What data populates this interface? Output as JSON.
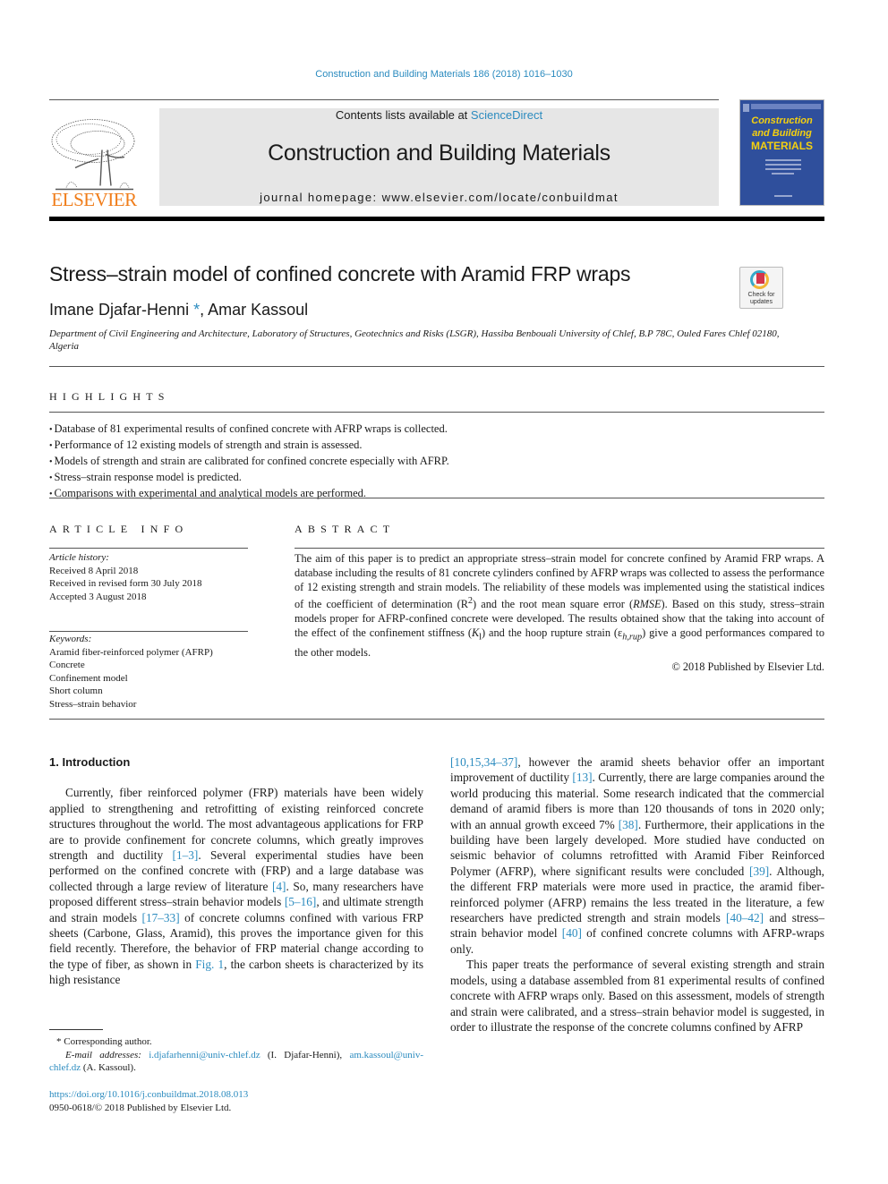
{
  "journal_ref": "Construction and Building Materials 186 (2018) 1016–1030",
  "publisher": {
    "logo_word": "ELSEVIER",
    "icon": "elsevier-tree-logo"
  },
  "banner": {
    "contents_prefix": "Contents lists available at ",
    "contents_link": "ScienceDirect",
    "journal_title": "Construction and Building Materials",
    "homepage": "journal homepage: www.elsevier.com/locate/conbuildmat"
  },
  "cover": {
    "line1": "Construction",
    "line2": "and Building",
    "line3": "MATERIALS"
  },
  "article": {
    "title": "Stress–strain model of confined concrete with Aramid FRP wraps",
    "author1": "Imane Djafar-Henni",
    "author1_mark": "*",
    "author_sep": ", ",
    "author2": "Amar Kassoul",
    "affiliation": "Department of Civil Engineering and Architecture, Laboratory of Structures, Geotechnics and Risks (LSGR), Hassiba Benbouali University of Chlef, B.P 78C, Ouled Fares Chlef 02180, Algeria",
    "check_updates": {
      "line1": "Check for",
      "line2": "updates"
    }
  },
  "highlights": {
    "heading": "HIGHLIGHTS",
    "items": [
      "Database of 81 experimental results of confined concrete with AFRP wraps is collected.",
      "Performance of 12 existing models of strength and strain is assessed.",
      "Models of strength and strain are calibrated for confined concrete especially with AFRP.",
      "Stress–strain response model is predicted.",
      "Comparisons with experimental and analytical models are performed."
    ]
  },
  "article_info": {
    "heading": "ARTICLE INFO",
    "history_label": "Article history:",
    "history": [
      "Received 8 April 2018",
      "Received in revised form 30 July 2018",
      "Accepted 3 August 2018"
    ],
    "keywords_label": "Keywords:",
    "keywords": [
      "Aramid fiber-reinforced polymer (AFRP)",
      "Concrete",
      "Confinement model",
      "Short column",
      "Stress–strain behavior"
    ]
  },
  "abstract": {
    "heading": "ABSTRACT",
    "p1": "The aim of this paper is to predict an appropriate stress–strain model for concrete confined by Aramid FRP wraps. A database including the results of 81 concrete cylinders confined by AFRP wraps was collected to assess the performance of 12 existing strength and strain models. The reliability of these models was implemented using the statistical indices of the coefficient of determination (R",
    "sup": "2",
    "p2": ") and the root mean square error (",
    "rmse": "RMSE",
    "p3": "). Based on this study, stress–strain models proper for AFRP-confined concrete were developed. The results obtained show that the taking into account of the effect of the confinement stiffness (",
    "kl": "K",
    "kl_sub": "l",
    "p4": ") and the hoop rupture strain (",
    "eps": "ε",
    "eps_sub": "h,rup",
    "p5": ") give a good performances compared to the other models.",
    "copyright": "© 2018 Published by Elsevier Ltd."
  },
  "intro": {
    "heading": "1. Introduction",
    "left": {
      "t1": "Currently, fiber reinforced polymer (FRP) materials have been widely applied to strengthening and retrofitting of existing reinforced concrete structures throughout the world. The most advantageous applications for FRP are to provide confinement for concrete columns, which greatly improves strength and ductility ",
      "r1": "[1–3]",
      "t2": ". Several experimental studies have been performed on the confined concrete with (FRP) and a large database was collected through a large review of literature ",
      "r2": "[4]",
      "t3": ". So, many researchers have proposed different stress–strain behavior models ",
      "r3": "[5–16]",
      "t4": ", and ultimate strength and strain models ",
      "r4": "[17–33]",
      "t5": " of concrete columns confined with various FRP sheets (Carbone, Glass, Aramid), this proves the importance given for this field recently. Therefore, the behavior of FRP material change according to the type of fiber, as shown in ",
      "r5": "Fig. 1",
      "t6": ", the carbon sheets is characterized by its high resistance"
    },
    "right": {
      "r1": "[10,15,34–37]",
      "t1": ", however the aramid sheets behavior offer an important improvement of ductility ",
      "r2": "[13]",
      "t2": ". Currently, there are large companies around the world producing this material. Some research indicated that the commercial demand of aramid fibers is more than 120 thousands of tons in 2020 only; with an annual growth exceed 7% ",
      "r3": "[38]",
      "t3": ". Furthermore, their applications in the building have been largely developed. More studied have conducted on seismic behavior of columns retrofitted with Aramid Fiber Reinforced Polymer (AFRP), where significant results were concluded ",
      "r4": "[39]",
      "t4": ". Although, the different FRP materials were more used in practice, the aramid fiber-reinforced polymer (AFRP) remains the less treated in the literature, a few researchers have predicted strength and strain models ",
      "r5": "[40–42]",
      "t5": " and stress–strain behavior model ",
      "r6": "[40]",
      "t6": " of confined concrete columns with AFRP-wraps only.",
      "p2": "This paper treats the performance of several existing strength and strain models, using a database assembled from 81 experimental results of confined concrete with AFRP wraps only. Based on this assessment, models of strength and strain were calibrated, and a stress–strain behavior model is suggested, in order to illustrate the response of the concrete columns confined by AFRP"
    }
  },
  "footnotes": {
    "corresponding": "* Corresponding author.",
    "email_label": "E-mail addresses: ",
    "email1": "i.djafarhenni@univ-chlef.dz",
    "email1_name": " (I. Djafar-Henni), ",
    "email2": "am.kassoul@univ-chlef.dz",
    "email2_name": " (A. Kassoul)."
  },
  "doi": {
    "link": "https://doi.org/10.1016/j.conbuildmat.2018.08.013",
    "issn": "0950-0618/© 2018 Published by Elsevier Ltd."
  }
}
